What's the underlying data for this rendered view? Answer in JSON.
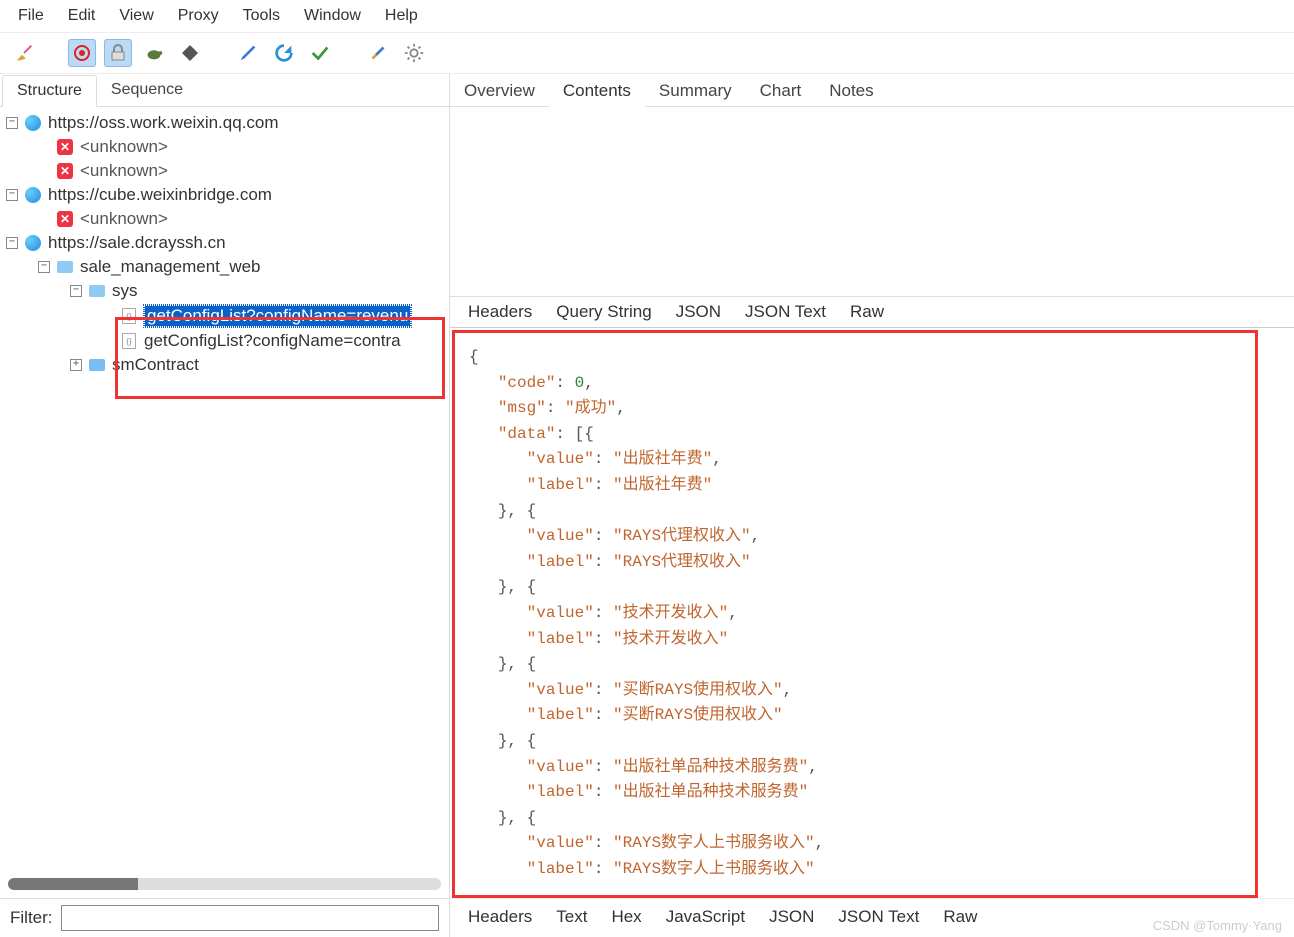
{
  "menubar": [
    "File",
    "Edit",
    "View",
    "Proxy",
    "Tools",
    "Window",
    "Help"
  ],
  "lefttabs": {
    "items": [
      "Structure",
      "Sequence"
    ],
    "active": 0
  },
  "righttabs": {
    "items": [
      "Overview",
      "Contents",
      "Summary",
      "Chart",
      "Notes"
    ],
    "active": 1
  },
  "subtabs_top": {
    "items": [
      "Headers",
      "Query String",
      "JSON",
      "JSON Text",
      "Raw"
    ],
    "active": 3
  },
  "subtabs_bottom": {
    "items": [
      "Headers",
      "Text",
      "Hex",
      "JavaScript",
      "JSON",
      "JSON Text",
      "Raw"
    ],
    "active": 5
  },
  "filter_label": "Filter:",
  "tree": {
    "hosts": [
      {
        "url": "https://oss.work.weixin.qq.com",
        "items": [
          "<unknown>",
          "<unknown>"
        ]
      },
      {
        "url": "https://cube.weixinbridge.com",
        "items": [
          "<unknown>"
        ]
      },
      {
        "url": "https://sale.dcrayssh.cn",
        "folder": "sale_management_web",
        "sub": "sys",
        "requests": [
          "getConfigList?configName=revenu",
          "getConfigList?configName=contra"
        ],
        "closed": "smContract"
      }
    ]
  },
  "json_response": {
    "code": 0,
    "msg": "成功",
    "data": [
      {
        "value": "出版社年费",
        "label": "出版社年费"
      },
      {
        "value": "RAYS代理权收入",
        "label": "RAYS代理权收入"
      },
      {
        "value": "技术开发收入",
        "label": "技术开发收入"
      },
      {
        "value": "买断RAYS使用权收入",
        "label": "买断RAYS使用权收入"
      },
      {
        "value": "出版社单品种技术服务费",
        "label": "出版社单品种技术服务费"
      },
      {
        "value": "RAYS数字人上书服务收入",
        "label": "RAYS数字人上书服务收入"
      }
    ]
  },
  "watermark": "CSDN @Tommy·Yang"
}
